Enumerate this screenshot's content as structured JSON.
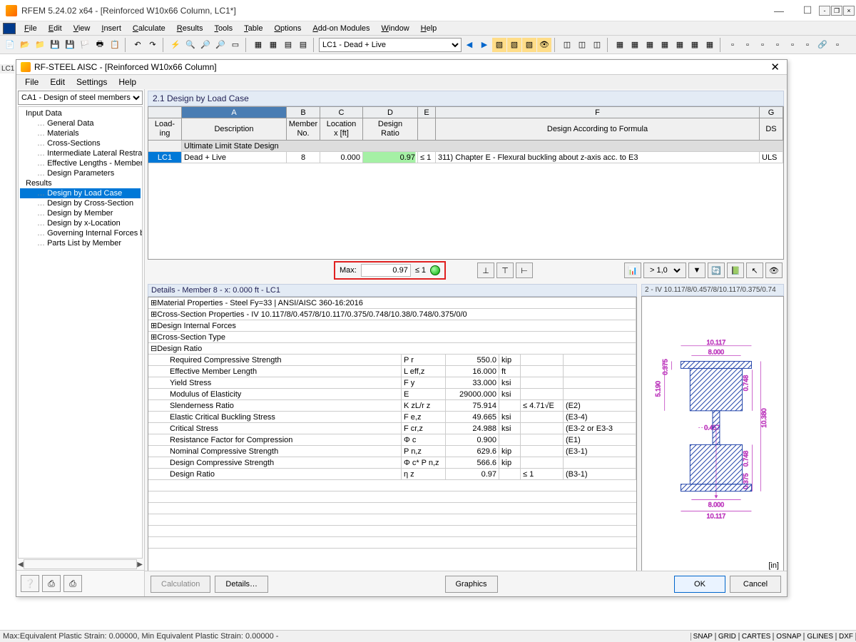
{
  "titlebar": {
    "text": "RFEM 5.24.02 x64 - [Reinforced W10x66 Column, LC1*]"
  },
  "mainMenu": [
    "File",
    "Edit",
    "View",
    "Insert",
    "Calculate",
    "Results",
    "Tools",
    "Table",
    "Options",
    "Add-on Modules",
    "Window",
    "Help"
  ],
  "lcSelect": "LC1 - Dead + Live",
  "lcRowLabel": "LC1",
  "module": {
    "title": "RF-STEEL AISC - [Reinforced W10x66 Column]",
    "menu": [
      "File",
      "Edit",
      "Settings",
      "Help"
    ],
    "navCombo": "CA1 - Design of steel members",
    "navTree": {
      "inputData": "Input Data",
      "items1": [
        "General Data",
        "Materials",
        "Cross-Sections",
        "Intermediate Lateral Restraints",
        "Effective Lengths - Members",
        "Design Parameters"
      ],
      "results": "Results",
      "items2": [
        "Design by Load Case",
        "Design by Cross-Section",
        "Design by Member",
        "Design by x-Location",
        "Governing Internal Forces by M",
        "Parts List by Member"
      ],
      "selected": "Design by Load Case"
    },
    "sectionHeader": "2.1 Design by Load Case",
    "grid": {
      "letters": [
        "",
        "A",
        "B",
        "C",
        "D",
        "E",
        "F",
        "G"
      ],
      "h1": {
        "c1a": "Load-",
        "c1b": "ing",
        "c2": "Description",
        "c3a": "Member",
        "c3b": "No.",
        "c4a": "Location",
        "c4b": "x [ft]",
        "c5a": "Design",
        "c5b": "Ratio",
        "c6": "",
        "c7": "Design According to Formula",
        "c8": "DS"
      },
      "catRow": "Ultimate Limit State Design",
      "row": {
        "lc": "LC1",
        "desc": "Dead + Live",
        "member": "8",
        "x": "0.000",
        "ratio": "0.97",
        "le": "≤ 1",
        "formula": "311) Chapter E - Flexural buckling about z-axis acc. to E3",
        "ds": "ULS"
      }
    },
    "max": {
      "label": "Max:",
      "value": "0.97",
      "le": "≤ 1"
    },
    "filter": "> 1,0",
    "detailsHeader": "Details - Member 8 - x: 0.000 ft - LC1",
    "detailRows": [
      {
        "label": "Material Properties - Steel Fy=33 | ANSI/AISC 360-16:2016",
        "exp": true
      },
      {
        "label": "Cross-Section Properties -  IV 10.117/8/0.457/8/10.117/0.375/0.748/10.38/0.748/0.375/0/0",
        "exp": true
      },
      {
        "label": "Design Internal Forces",
        "exp": true
      },
      {
        "label": "Cross-Section Type",
        "exp": true
      },
      {
        "label": "Design Ratio",
        "exp": true,
        "open": true
      }
    ],
    "designRatioRows": [
      {
        "l": "Required Compressive Strength",
        "s": "P r",
        "v": "550.0",
        "u": "kip",
        "c": "",
        "r": ""
      },
      {
        "l": "Effective Member Length",
        "s": "L eff,z",
        "v": "16.000",
        "u": "ft",
        "c": "",
        "r": ""
      },
      {
        "l": "Yield Stress",
        "s": "F y",
        "v": "33.000",
        "u": "ksi",
        "c": "",
        "r": ""
      },
      {
        "l": "Modulus of Elasticity",
        "s": "E",
        "v": "29000.000",
        "u": "ksi",
        "c": "",
        "r": ""
      },
      {
        "l": "Slenderness Ratio",
        "s": "K zL/r z",
        "v": "75.914",
        "u": "",
        "c": "≤ 4.71√E",
        "r": "(E2)"
      },
      {
        "l": "Elastic Critical Buckling Stress",
        "s": "F e,z",
        "v": "49.665",
        "u": "ksi",
        "c": "",
        "r": "(E3-4)"
      },
      {
        "l": "Critical Stress",
        "s": "F cr,z",
        "v": "24.988",
        "u": "ksi",
        "c": "",
        "r": "(E3-2 or E3-3"
      },
      {
        "l": "Resistance Factor for Compression",
        "s": "Φ c",
        "v": "0.900",
        "u": "",
        "c": "",
        "r": "(E1)"
      },
      {
        "l": "Nominal Compressive Strength",
        "s": "P n,z",
        "v": "629.6",
        "u": "kip",
        "c": "",
        "r": "(E3-1)"
      },
      {
        "l": "Design Compressive Strength",
        "s": "Φ c* P n,z",
        "v": "566.6",
        "u": "kip",
        "c": "",
        "r": ""
      },
      {
        "l": "Design Ratio",
        "s": "η z",
        "v": "0.97",
        "u": "",
        "c": "≤ 1",
        "r": "(B3-1)"
      }
    ],
    "csHeader": "2 - IV 10.117/8/0.457/8/10.117/0.375/0.74",
    "csUnit": "[in]",
    "dims": {
      "w": "10.117",
      "fw": "8.000",
      "tw": "0.457",
      "tf1": "0.375",
      "tf2": "0.748",
      "tf3": "0.748",
      "tf4": "0.375",
      "h": "10.380",
      "hi": "5.190"
    },
    "btnCalc": "Calculation",
    "btnDetails": "Details…",
    "btnGraphics": "Graphics",
    "btnOK": "OK",
    "btnCancel": "Cancel"
  },
  "statusbar": {
    "text": "Max:Equivalent Plastic Strain: 0.00000, Min Equivalent Plastic Strain: 0.00000 -"
  },
  "pills": [
    "SNAP",
    "GRID",
    "CARTES",
    "OSNAP",
    "GLINES",
    "DXF"
  ]
}
